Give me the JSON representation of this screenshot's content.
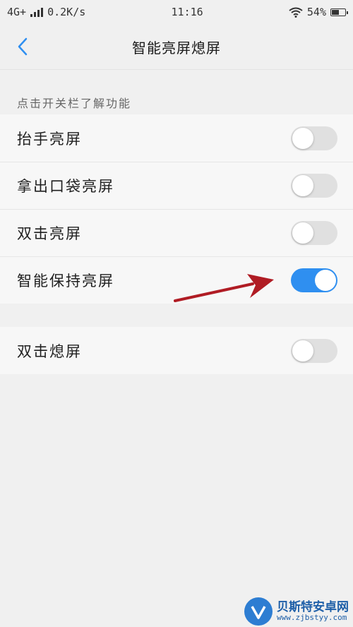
{
  "status_bar": {
    "network": "4G+",
    "speed": "0.2K/s",
    "time": "11:16",
    "battery": "54%"
  },
  "header": {
    "title": "智能亮屏熄屏"
  },
  "hint": "点击开关栏了解功能",
  "group1": [
    {
      "label": "抬手亮屏",
      "on": false
    },
    {
      "label": "拿出口袋亮屏",
      "on": false
    },
    {
      "label": "双击亮屏",
      "on": false
    },
    {
      "label": "智能保持亮屏",
      "on": true
    }
  ],
  "group2": [
    {
      "label": "双击熄屏",
      "on": false
    }
  ],
  "colors": {
    "accent": "#2f8ff0",
    "toggle_off": "#e0e0e0",
    "annotation_arrow": "#b01c24"
  },
  "watermark": {
    "name": "贝斯特安卓网",
    "url": "www.zjbstyy.com"
  },
  "icons": [
    "back-icon",
    "signal-icon",
    "wifi-icon",
    "battery-icon",
    "arrow-annotation"
  ]
}
